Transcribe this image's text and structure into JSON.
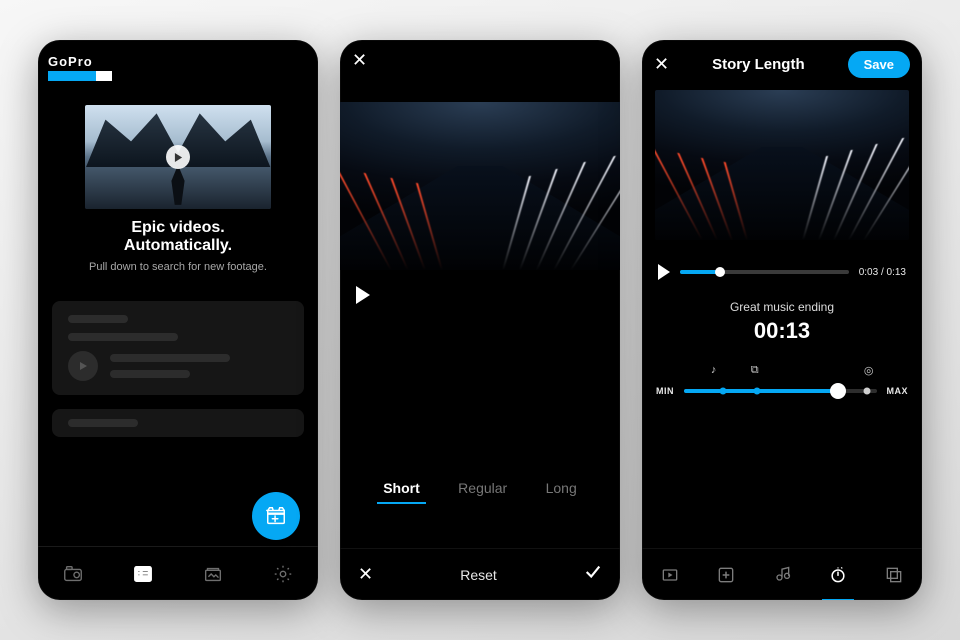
{
  "colors": {
    "accent": "#05a8f4"
  },
  "phone1": {
    "logo_text": "GoPro",
    "logo_squares": [
      "#05a8f4",
      "#05a8f4",
      "#05a8f4",
      "#ffffff"
    ],
    "hero_title": "Epic videos. Automatically.",
    "hero_subtitle": "Pull down to search for new footage.",
    "tabs": [
      {
        "name": "camera",
        "active": false
      },
      {
        "name": "feed",
        "active": true
      },
      {
        "name": "media",
        "active": false
      },
      {
        "name": "settings",
        "active": false
      }
    ],
    "fab": "create-video"
  },
  "phone2": {
    "length_options": [
      "Short",
      "Regular",
      "Long"
    ],
    "length_selected": "Short",
    "bottom": {
      "cancel": "✕",
      "reset": "Reset",
      "confirm": "✓"
    }
  },
  "phone3": {
    "header": {
      "close": "✕",
      "title": "Story Length",
      "save": "Save"
    },
    "playback": {
      "current": "0:03",
      "total": "0:13",
      "progress_pct": 24
    },
    "ending_label": "Great music ending",
    "duration": "00:13",
    "slider": {
      "min_label": "MIN",
      "max_label": "MAX",
      "marks": [
        {
          "name": "music-note",
          "pos_pct": 20,
          "glyph": "♪"
        },
        {
          "name": "video",
          "pos_pct": 38,
          "glyph": "⧉"
        },
        {
          "name": "social",
          "pos_pct": 88,
          "glyph": "◎"
        }
      ],
      "value_pct": 80
    },
    "bottom_tabs": [
      {
        "name": "clips",
        "active": false
      },
      {
        "name": "add",
        "active": false
      },
      {
        "name": "music",
        "active": false
      },
      {
        "name": "length",
        "active": true
      },
      {
        "name": "layout",
        "active": false
      }
    ]
  }
}
